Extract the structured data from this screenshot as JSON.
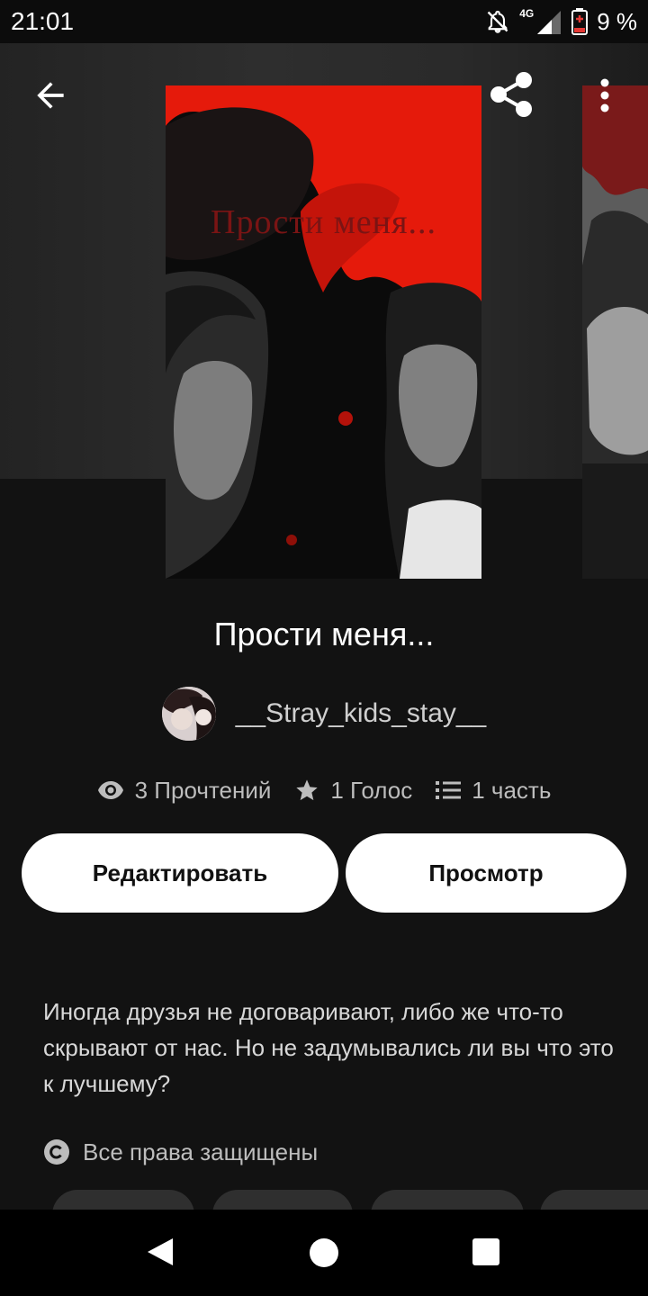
{
  "status_bar": {
    "time": "21:01",
    "network": "4G",
    "battery": "9 %",
    "icons": [
      "notifications-off-icon",
      "signal-4g-icon",
      "battery-low-icon"
    ]
  },
  "header": {
    "back_icon": "arrow-left-icon",
    "share_icon": "share-icon",
    "more_icon": "more-vertical-icon"
  },
  "cover": {
    "title_text": "Прости меня..."
  },
  "story": {
    "title": "Прости меня...",
    "author": "__Stray_kids_stay__",
    "stats": {
      "reads": "3 Прочтений",
      "votes": "1 Голос",
      "parts": "1 часть"
    },
    "actions": {
      "edit_label": "Редактировать",
      "view_label": "Просмотр"
    },
    "description": "Иногда  друзья не договаривают, либо же что-то скрывают от нас. Но не задумывались ли вы что это к лучшему?",
    "rights": "Все права защищены"
  },
  "colors": {
    "background": "#121212",
    "button_bg": "#ffffff",
    "cover_red": "#e0180c"
  }
}
